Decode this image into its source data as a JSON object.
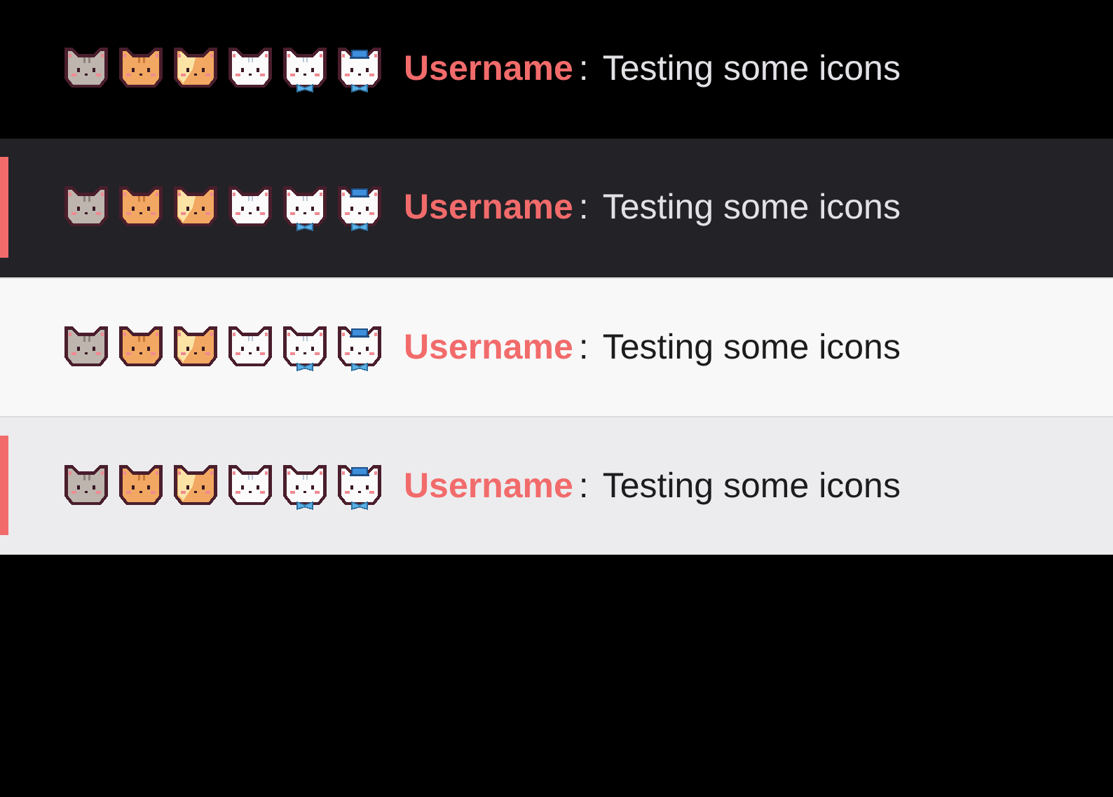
{
  "rows": [
    {
      "dark": true,
      "highlighted": false,
      "icons": [
        {
          "kind": "grey"
        },
        {
          "kind": "orange"
        },
        {
          "kind": "calico"
        },
        {
          "kind": "white"
        },
        {
          "kind": "bow"
        },
        {
          "kind": "hat"
        }
      ],
      "username": "Username",
      "separator": ":",
      "message": "Testing some icons"
    },
    {
      "dark": true,
      "highlighted": true,
      "icons": [
        {
          "kind": "grey"
        },
        {
          "kind": "orange"
        },
        {
          "kind": "calico"
        },
        {
          "kind": "white"
        },
        {
          "kind": "bow"
        },
        {
          "kind": "hat"
        }
      ],
      "username": "Username",
      "separator": ":",
      "message": "Testing some icons"
    },
    {
      "dark": false,
      "highlighted": false,
      "icons": [
        {
          "kind": "grey"
        },
        {
          "kind": "orange"
        },
        {
          "kind": "calico"
        },
        {
          "kind": "white"
        },
        {
          "kind": "bow"
        },
        {
          "kind": "hat"
        }
      ],
      "username": "Username",
      "separator": ":",
      "message": "Testing some icons"
    },
    {
      "dark": false,
      "highlighted": true,
      "icons": [
        {
          "kind": "grey"
        },
        {
          "kind": "orange"
        },
        {
          "kind": "calico"
        },
        {
          "kind": "white"
        },
        {
          "kind": "bow"
        },
        {
          "kind": "hat"
        }
      ],
      "username": "Username",
      "separator": ":",
      "message": "Testing some icons"
    }
  ]
}
